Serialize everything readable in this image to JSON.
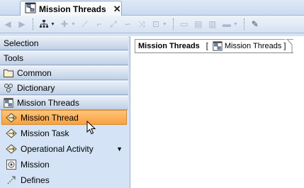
{
  "tab": {
    "title": "Mission Threads",
    "close": "✕"
  },
  "palette": {
    "sections": [
      {
        "label": "Selection"
      },
      {
        "label": "Tools"
      },
      {
        "label": "Common"
      },
      {
        "label": "Dictionary"
      },
      {
        "label": "Mission Threads"
      }
    ],
    "items": [
      {
        "label": "Mission Thread",
        "selected": true
      },
      {
        "label": "Mission Task"
      },
      {
        "label": "Operational Activity",
        "has_dropdown": true
      },
      {
        "label": "Mission"
      },
      {
        "label": "Defines"
      }
    ],
    "dropdown_arrow": "▼"
  },
  "diagram": {
    "title": "Mission Threads",
    "open_bracket": "[",
    "diagram_name": "Mission Threads",
    "close_bracket": "]"
  },
  "colors": {
    "selected_item": "#f7a140",
    "palette_bg": "#d4e3f5"
  }
}
